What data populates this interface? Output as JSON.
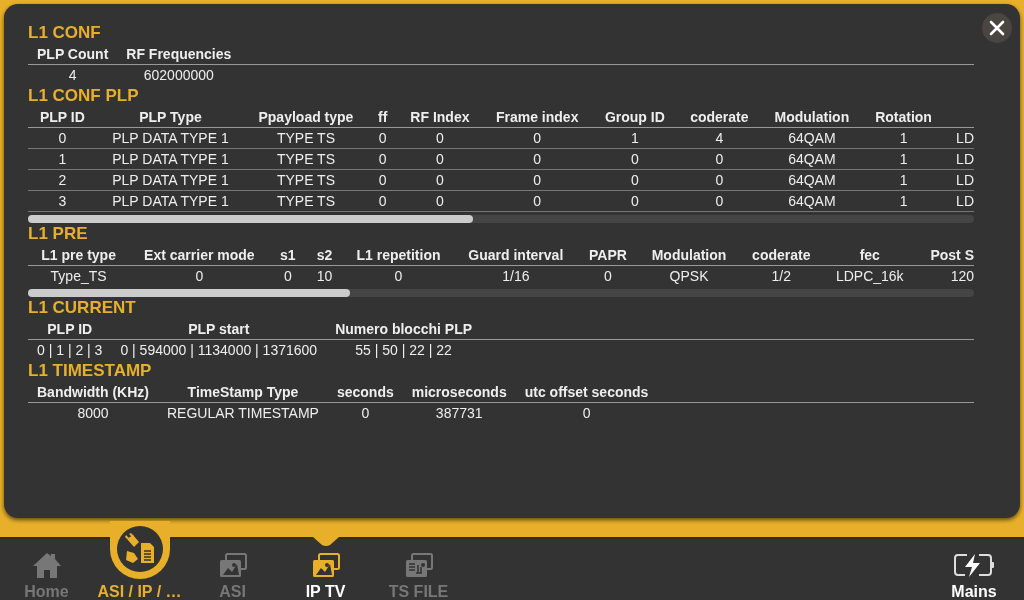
{
  "sections": [
    {
      "title": "L1 CONF",
      "kind": "plain",
      "columns": [
        "PLP Count",
        "RF Frequencies"
      ],
      "rows": [
        [
          "4",
          "602000000"
        ]
      ]
    },
    {
      "title": "L1 CONF PLP",
      "kind": "scrolling",
      "columns": [
        "PLP ID",
        "PLP Type",
        "Ppayload type",
        "ff",
        "RF Index",
        "Frame index",
        "Group ID",
        "coderate",
        "Modulation",
        "Rotation",
        ""
      ],
      "rows": [
        [
          "0",
          "PLP DATA TYPE 1",
          "TYPE TS",
          "0",
          "0",
          "0",
          "1",
          "4",
          "64QAM",
          "1",
          "LD"
        ],
        [
          "1",
          "PLP DATA TYPE 1",
          "TYPE TS",
          "0",
          "0",
          "0",
          "0",
          "0",
          "64QAM",
          "1",
          "LD"
        ],
        [
          "2",
          "PLP DATA TYPE 1",
          "TYPE TS",
          "0",
          "0",
          "0",
          "0",
          "0",
          "64QAM",
          "1",
          "LD"
        ],
        [
          "3",
          "PLP DATA TYPE 1",
          "TYPE TS",
          "0",
          "0",
          "0",
          "0",
          "0",
          "64QAM",
          "1",
          "LD"
        ]
      ]
    },
    {
      "title": "L1 PRE",
      "kind": "scrolling",
      "columns": [
        "L1 pre type",
        "Ext carrier mode",
        "s1",
        "s2",
        "L1 repetition",
        "Guard interval",
        "PAPR",
        "Modulation",
        "coderate",
        "fec",
        "Post S"
      ],
      "rows": [
        [
          "Type_TS",
          "0",
          "0",
          "10",
          "0",
          "1/16",
          "0",
          "QPSK",
          "1/2",
          "LDPC_16k",
          "120"
        ]
      ]
    },
    {
      "title": "L1 CURRENT",
      "kind": "plain",
      "columns": [
        "PLP ID",
        "PLP start",
        "Numero blocchi PLP"
      ],
      "rows": [
        [
          "0 | 1 | 2 | 3",
          "0 | 594000 | 1134000 | 1371600",
          "55 | 50 | 22 | 22"
        ]
      ]
    },
    {
      "title": "L1 TIMESTAMP",
      "kind": "plain",
      "columns": [
        "Bandwidth (KHz)",
        "TimeStamp Type",
        "seconds",
        "microseconds",
        "utc offset seconds"
      ],
      "rows": [
        [
          "8000",
          "REGULAR TIMESTAMP",
          "0",
          "387731",
          "0"
        ]
      ]
    }
  ],
  "nav": [
    {
      "label": "Home",
      "selected": false,
      "active": false
    },
    {
      "label": "ASI / IP / …",
      "selected": true,
      "active": false
    },
    {
      "label": "ASI",
      "selected": false,
      "active": false
    },
    {
      "label": "IP TV",
      "selected": false,
      "active": true
    },
    {
      "label": "TS FILE",
      "selected": false,
      "active": false
    }
  ],
  "power": {
    "label": "Mains"
  }
}
